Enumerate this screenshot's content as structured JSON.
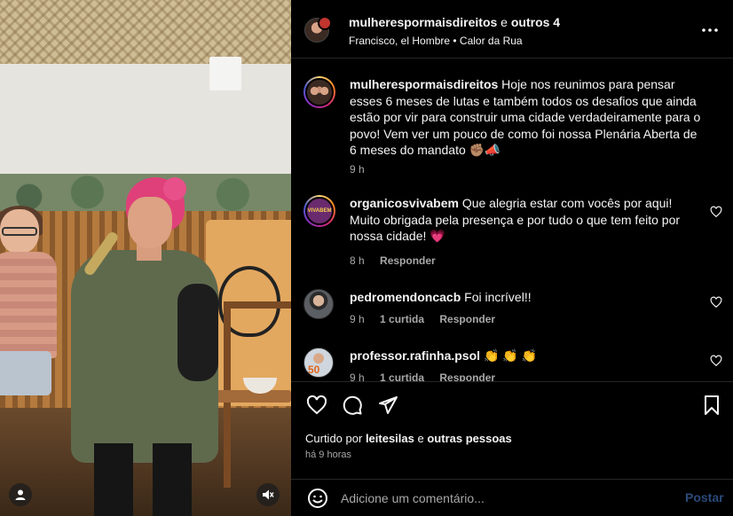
{
  "header": {
    "username": "mulherespormaisdireitos",
    "and_text": "e",
    "others": "outros 4",
    "audio": "Francisco, el Hombre • Calor da Rua"
  },
  "caption": {
    "username": "mulherespormaisdireitos",
    "text": "Hoje nos reunimos para pensar esses 6 meses de lutas e também todos os desafios que ainda estão por vir para construir uma cidade verdadeiramente para o povo! Vem ver um pouco de como foi nossa Plenária Aberta de 6 meses do mandato ✊🏽📣",
    "time": "9 h"
  },
  "comments": [
    {
      "username": "organicosvivabem",
      "text": "Que alegria estar com vocês por aqui! Muito obrigada pela presença e por tudo o que tem feito por nossa cidade! 💗",
      "time": "8 h",
      "likes": "",
      "reply": "Responder"
    },
    {
      "username": "pedromendoncacb",
      "text": "Foi incrível!!",
      "time": "9 h",
      "likes": "1 curtida",
      "reply": "Responder"
    },
    {
      "username": "professor.rafinha.psol",
      "text": "👏 👏 👏",
      "time": "9 h",
      "likes": "1 curtida",
      "reply": "Responder"
    }
  ],
  "likes": {
    "prefix": "Curtido por",
    "user": "leitesilas",
    "connector": "e",
    "others": "outras pessoas"
  },
  "post_time": "há 9 horas",
  "add_comment": {
    "placeholder": "Adicione um comentário...",
    "post_label": "Postar"
  },
  "media": {
    "avatar_badge": "50"
  },
  "colors": {
    "background": "#000000",
    "text": "#f5f5f5",
    "muted": "#a8a8a8",
    "post_button_disabled": "#2a4a7a",
    "heart_emoji": "#e8508a"
  },
  "icons": [
    "more-icon",
    "heart-icon",
    "comment-icon",
    "share-icon",
    "bookmark-icon",
    "emoji-icon",
    "user-icon",
    "mute-icon"
  ]
}
